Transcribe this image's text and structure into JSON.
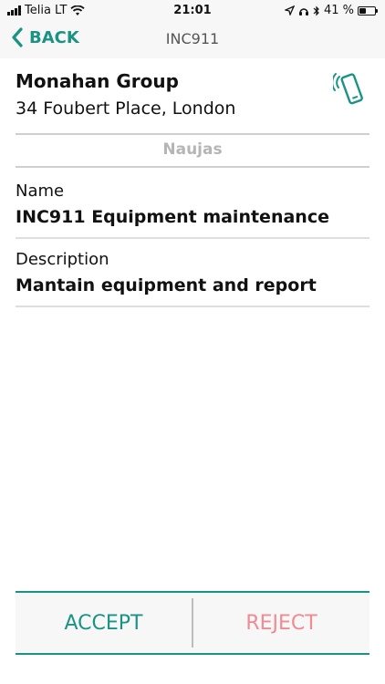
{
  "status_bar": {
    "carrier": "Telia LT",
    "time": "21:01",
    "battery_percent": "41 %",
    "battery_level": 0.41
  },
  "nav": {
    "back_label": "BACK",
    "title": "INC911"
  },
  "customer": {
    "name": "Monahan Group",
    "address": "34 Foubert Place, London"
  },
  "status": "Naujas",
  "fields": {
    "name_label": "Name",
    "name_value": "INC911 Equipment maintenance",
    "description_label": "Description",
    "description_value": "Mantain equipment and report"
  },
  "actions": {
    "accept_label": "ACCEPT",
    "reject_label": "REJECT"
  },
  "colors": {
    "accent": "#1a9384",
    "reject": "#f08a93",
    "status_text": "#b5b5b5"
  },
  "icons": {
    "phone": "phone-ringing-icon",
    "back": "chevron-left-icon"
  }
}
